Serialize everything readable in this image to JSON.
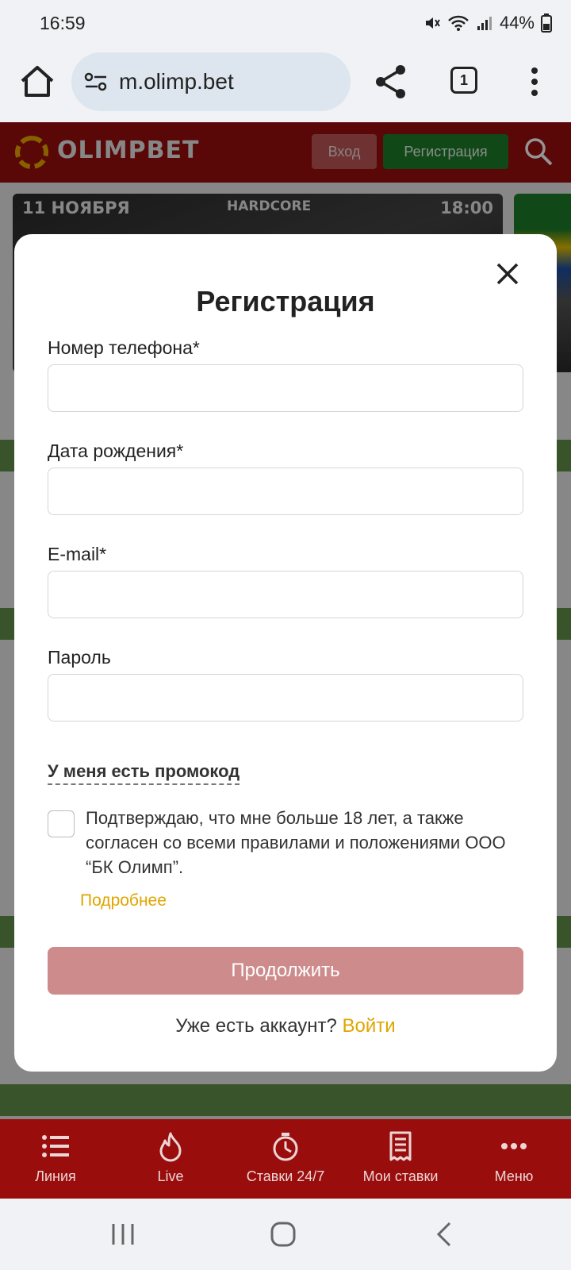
{
  "status_bar": {
    "time": "16:59",
    "battery": "44%"
  },
  "browser": {
    "url": "m.olimp.bet",
    "tab_count": "1"
  },
  "site": {
    "logo_text": "OLIMPBET",
    "login_label": "Вход",
    "register_label": "Регистрация",
    "banner": {
      "date": "11 НОЯБРЯ",
      "brand": "HARDCORE",
      "time": "18:00"
    }
  },
  "modal": {
    "title": "Регистрация",
    "phone_label": "Номер телефона*",
    "birth_label": "Дата рождения*",
    "email_label": "E-mail*",
    "password_label": "Пароль",
    "promo_label": "У меня есть промокод",
    "agree_text": "Подтверждаю, что мне больше 18 лет, а также согласен со всеми правилами и положениями ООО “БК Олимп”.",
    "more_link": "Подробнее",
    "continue_label": "Продолжить",
    "have_account": "Уже есть аккаунт?",
    "login_link": "Войти"
  },
  "bottom_nav": [
    {
      "label": "Линия",
      "icon": "list-icon"
    },
    {
      "label": "Live",
      "icon": "flame-icon"
    },
    {
      "label": "Ставки 24/7",
      "icon": "stopwatch-icon"
    },
    {
      "label": "Мои ставки",
      "icon": "receipt-icon"
    },
    {
      "label": "Меню",
      "icon": "more-horizontal-icon"
    }
  ],
  "colors": {
    "brand_red": "#9a0d0d",
    "register_green": "#1e7d2a",
    "link_yellow": "#e0a500",
    "disabled_button": "#cd8b8b"
  }
}
